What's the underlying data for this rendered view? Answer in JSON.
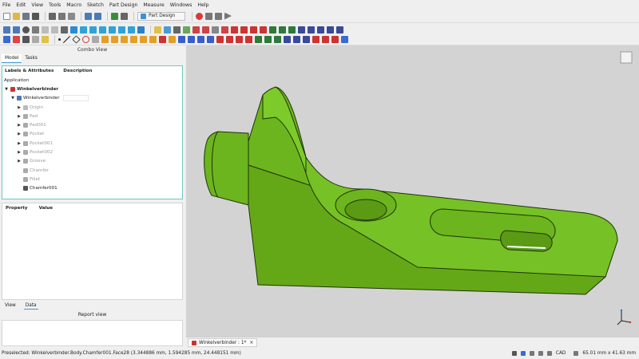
{
  "menu": [
    "File",
    "Edit",
    "View",
    "Tools",
    "Macro",
    "Sketch",
    "Part Design",
    "Measure",
    "Windows",
    "Help"
  ],
  "workbench": {
    "label": "Part Design"
  },
  "combo": {
    "title": "Combo View",
    "tabs": [
      "Model",
      "Tasks"
    ],
    "tree_headers": [
      "Labels & Attributes",
      "Description"
    ],
    "root": "Application",
    "document": "Winkelverbinder",
    "body": "Winkelverbinder",
    "features": [
      "Origin",
      "Pad",
      "Pad001",
      "Pocket",
      "Pocket001",
      "Pocket002",
      "Groove",
      "Chamfer",
      "Fillet",
      "Chamfer001"
    ],
    "property_headers": [
      "Property",
      "Value"
    ],
    "view_tabs": [
      "View",
      "Data"
    ]
  },
  "report": {
    "title": "Report view"
  },
  "doc_tab": {
    "label": "Winkelverbinder : 1*",
    "close": "×"
  },
  "status": {
    "text": "Preselected: Winkelverbinder.Body.Chamfer001.Face28 (3.344886 mm, 1.594285 mm, 24.448151 mm)",
    "nav_style": "CAD",
    "dimensions": "65.01 mm x 41.63 mm"
  },
  "colors": {
    "part_fill": "#6cb51e",
    "part_edge": "#1f3306",
    "viewport_bg": "#d3d3d3",
    "tree_border": "#6cc9c0"
  }
}
